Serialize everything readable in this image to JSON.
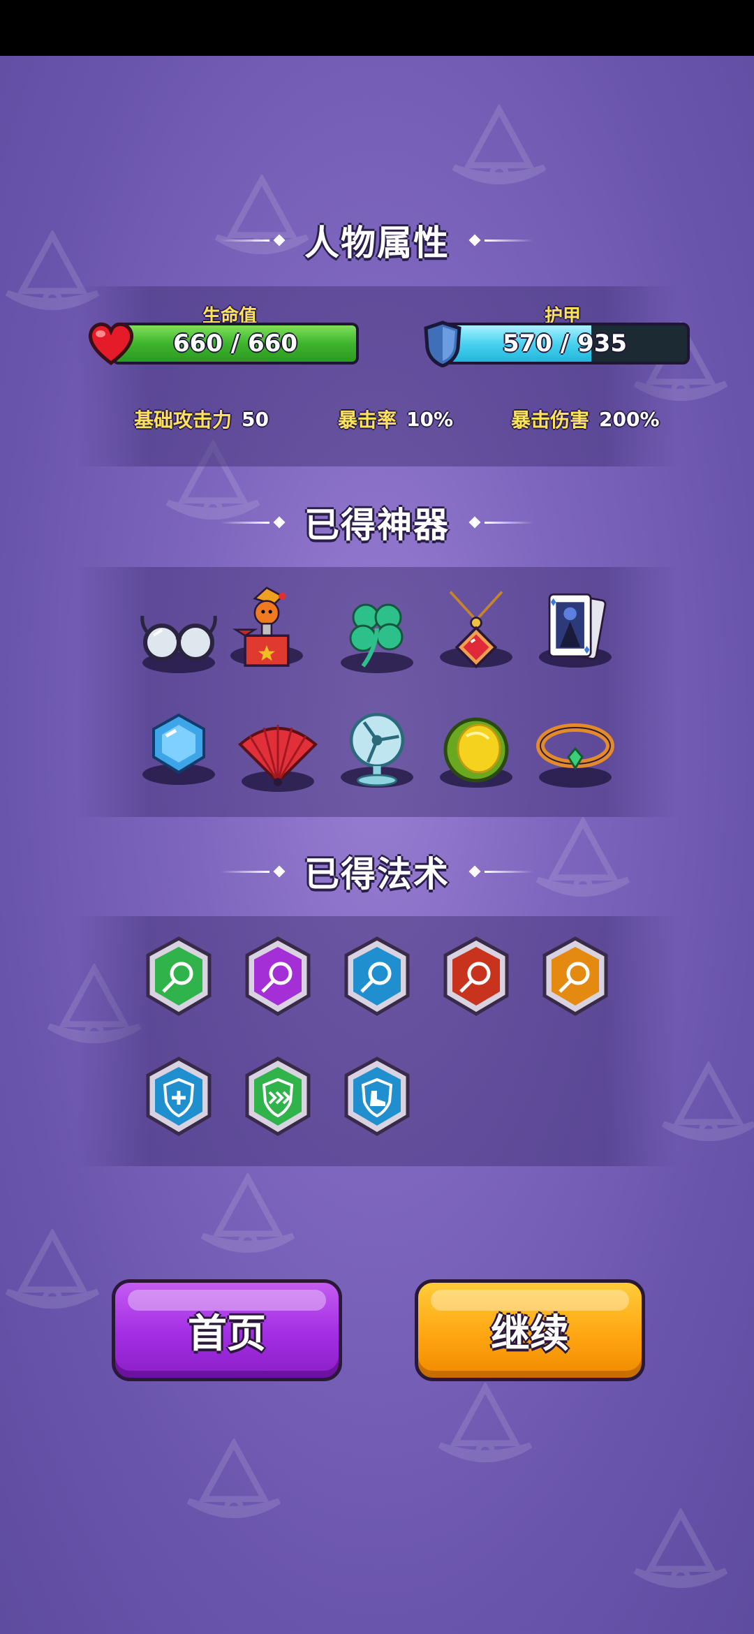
{
  "sections": {
    "attributes_title": "人物属性",
    "artifacts_title": "已得神器",
    "spells_title": "已得法术"
  },
  "hp": {
    "label": "生命值",
    "current": 660,
    "max": 660,
    "text": "660 / 660",
    "color": "#3fb52d"
  },
  "armor": {
    "label": "护甲",
    "current": 570,
    "max": 935,
    "text": "570 / 935",
    "color": "#4ad2ef"
  },
  "stats": [
    {
      "label": "基础攻击力",
      "value": "50"
    },
    {
      "label": "暴击率",
      "value": "10%"
    },
    {
      "label": "暴击伤害",
      "value": "200%"
    }
  ],
  "artifacts": [
    {
      "icon": "glasses-icon"
    },
    {
      "icon": "jack-in-the-box-icon"
    },
    {
      "icon": "four-leaf-clover-icon"
    },
    {
      "icon": "ruby-pendant-icon"
    },
    {
      "icon": "queen-playing-card-icon"
    },
    {
      "icon": "blue-gem-icon"
    },
    {
      "icon": "red-fan-icon"
    },
    {
      "icon": "desk-fan-icon"
    },
    {
      "icon": "durian-icon"
    },
    {
      "icon": "emerald-bracelet-icon"
    }
  ],
  "spells": [
    {
      "icon": "green-orb-spell-icon",
      "color": "#2fb34a"
    },
    {
      "icon": "purple-orb-spell-icon",
      "color": "#a52fd6"
    },
    {
      "icon": "blue-orb-spell-icon",
      "color": "#1f8fd0"
    },
    {
      "icon": "red-orb-spell-icon",
      "color": "#c8331e"
    },
    {
      "icon": "orange-orb-spell-icon",
      "color": "#e58a10"
    },
    {
      "icon": "heal-shield-spell-icon",
      "color": "#1f8fd0"
    },
    {
      "icon": "speed-shield-spell-icon",
      "color": "#2fb34a"
    },
    {
      "icon": "boot-shield-spell-icon",
      "color": "#1f8fd0"
    }
  ],
  "buttons": {
    "home": "首页",
    "continue": "继续"
  }
}
